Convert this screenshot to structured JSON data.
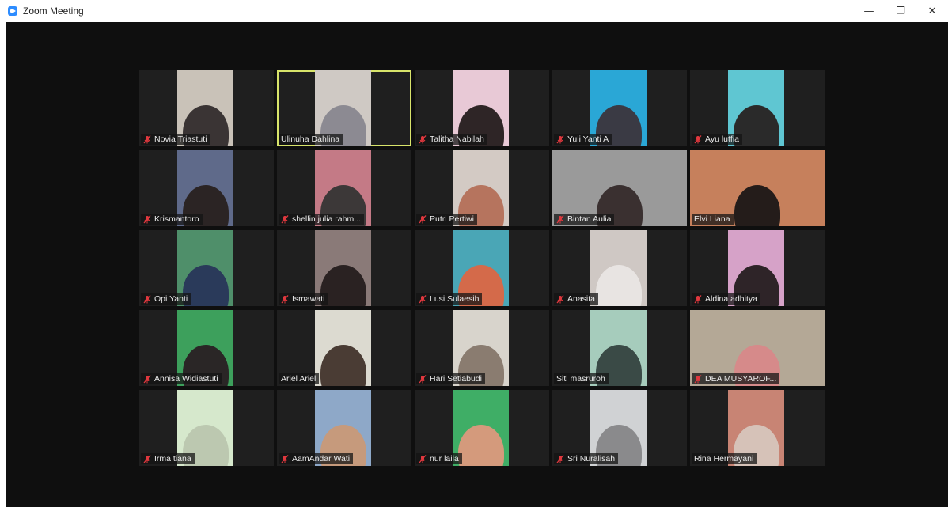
{
  "window": {
    "title": "Zoom Meeting",
    "controls": {
      "minimize": "—",
      "restore": "❐",
      "close": "✕"
    }
  },
  "colors": {
    "active_speaker_border": "#d8e46a",
    "mute_icon": "#e0383e",
    "accent": "#2d8cff"
  },
  "participants": [
    {
      "name": "Novia Triastuti",
      "muted": true,
      "bg": "#c9c2b8",
      "head": "#3a3434"
    },
    {
      "name": "Ulinuha Dahlina",
      "muted": false,
      "active": true,
      "bg": "#cfc9c4",
      "head": "#8c8a92"
    },
    {
      "name": "Talitha Nabilah",
      "muted": true,
      "bg": "#e8c9d6",
      "head": "#2e2526"
    },
    {
      "name": "Yuli Yanti A",
      "muted": true,
      "bg": "#2aa7d6",
      "head": "#3a3a44"
    },
    {
      "name": "Ayu lutfia",
      "muted": true,
      "bg": "#5fc6d2",
      "head": "#2a2a2a"
    },
    {
      "name": "Krismantoro",
      "muted": true,
      "bg": "#5f6a8a",
      "head": "#2b2424"
    },
    {
      "name": "shellin julia rahm...",
      "muted": true,
      "bg": "#c47a86",
      "head": "#3c3838"
    },
    {
      "name": "Putri Pertiwi",
      "muted": true,
      "bg": "#d3cac4",
      "head": "#b6745e"
    },
    {
      "name": "Bintan Aulia",
      "muted": true,
      "bg": "#9a9a9a",
      "head": "#3a3030",
      "wide": true
    },
    {
      "name": "Elvi Liana",
      "muted": false,
      "bg": "#c6805c",
      "head": "#241c1a",
      "wide": true
    },
    {
      "name": "Opi Yanti",
      "muted": true,
      "bg": "#4f8f6a",
      "head": "#2a3a5a"
    },
    {
      "name": "Ismawati",
      "muted": true,
      "bg": "#8a7a78",
      "head": "#2a2222"
    },
    {
      "name": "Lusi Sulaesih",
      "muted": true,
      "bg": "#4aa6b6",
      "head": "#d46a4a"
    },
    {
      "name": "Anasita",
      "muted": true,
      "bg": "#cfc8c4",
      "head": "#e8e4e2"
    },
    {
      "name": "Aldina adhitya",
      "muted": true,
      "bg": "#d6a2c8",
      "head": "#2e2428"
    },
    {
      "name": "Annisa Widiastuti",
      "muted": true,
      "bg": "#3da05c",
      "head": "#2a2626"
    },
    {
      "name": "Ariel Ariel",
      "muted": false,
      "bg": "#dcdad0",
      "head": "#4a3c34"
    },
    {
      "name": "Hari Setiabudi",
      "muted": true,
      "bg": "#d8d4cc",
      "head": "#8a7c70"
    },
    {
      "name": "Siti masruroh",
      "muted": false,
      "bg": "#a6ccbc",
      "head": "#3a4a46"
    },
    {
      "name": "DEA MUSYAROF...",
      "muted": true,
      "bg": "#b4a896",
      "head": "#d68a8a",
      "wide": true
    },
    {
      "name": "Irma tiana",
      "muted": true,
      "bg": "#d6e8cc",
      "head": "#bcc8b0"
    },
    {
      "name": "AamAndar Wati",
      "muted": true,
      "bg": "#8ea8c8",
      "head": "#c69a7c"
    },
    {
      "name": "nur laila",
      "muted": true,
      "bg": "#3fae66",
      "head": "#d49a7c"
    },
    {
      "name": "Sri Nuralisah",
      "muted": true,
      "bg": "#d0d2d4",
      "head": "#8a8a8c"
    },
    {
      "name": "Rina Hermayani",
      "muted": false,
      "bg": "#c88474",
      "head": "#d6c2b8"
    }
  ]
}
